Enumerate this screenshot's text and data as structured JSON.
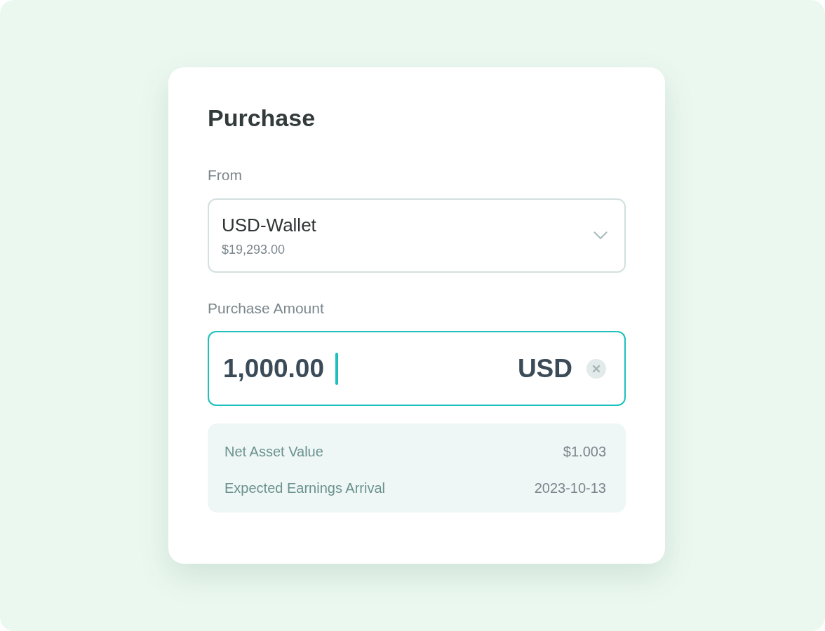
{
  "title": "Purchase",
  "from": {
    "label": "From",
    "wallet": {
      "name": "USD-Wallet",
      "balance": "$19,293.00"
    }
  },
  "amount": {
    "label": "Purchase Amount",
    "value": "1,000.00",
    "currency": "USD",
    "focused": true
  },
  "details": [
    {
      "label": "Net Asset Value",
      "value": "$1.003"
    },
    {
      "label": "Expected Earnings Arrival",
      "value": "2023-10-13"
    }
  ]
}
